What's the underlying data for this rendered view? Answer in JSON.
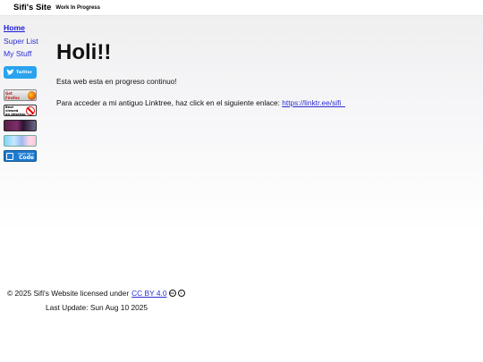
{
  "header": {
    "title": "Sifi's Site",
    "subtitle": "Work In Progress"
  },
  "sidebar": {
    "items": [
      {
        "label": "Home",
        "active": true
      },
      {
        "label": "Super List",
        "active": false
      },
      {
        "label": "My Stuff",
        "active": false
      }
    ]
  },
  "badges": {
    "twitter": {
      "label": "Twitter",
      "icon": "twitter-bird-icon"
    },
    "firefox": {
      "label": "Get Firefox",
      "icon": "firefox-icon"
    },
    "desktop": {
      "line1": "Best viewed",
      "line2": "on desktop",
      "icon": "no-sign-icon"
    },
    "pixel": {
      "label": "",
      "icon": "pixel-art-icon"
    },
    "anime": {
      "icon": "anime-art-icon"
    },
    "vscode": {
      "line1": "MADE WITH",
      "line2": "Code",
      "icon": "vscode-icon"
    }
  },
  "main": {
    "heading": "Holi!!",
    "paragraph1": "Esta web esta en progreso continuo!",
    "paragraph2_prefix": "Para acceder a mi antiguo Linktree, haz click en el siguiente enlace: ",
    "link_text": "https://linktr.ee/sifi_"
  },
  "footer": {
    "license_prefix": "© 2025 Sifi's Website licensed under",
    "license_link": "CC BY 4.0",
    "icons": [
      "cc-icon",
      "by-icon"
    ],
    "last_update": "Last Update: Sun Aug 10 2025"
  },
  "colors": {
    "link": "#2d2dd2",
    "twitter": "#2aa3ef",
    "vscode": "#1d7cd1"
  }
}
